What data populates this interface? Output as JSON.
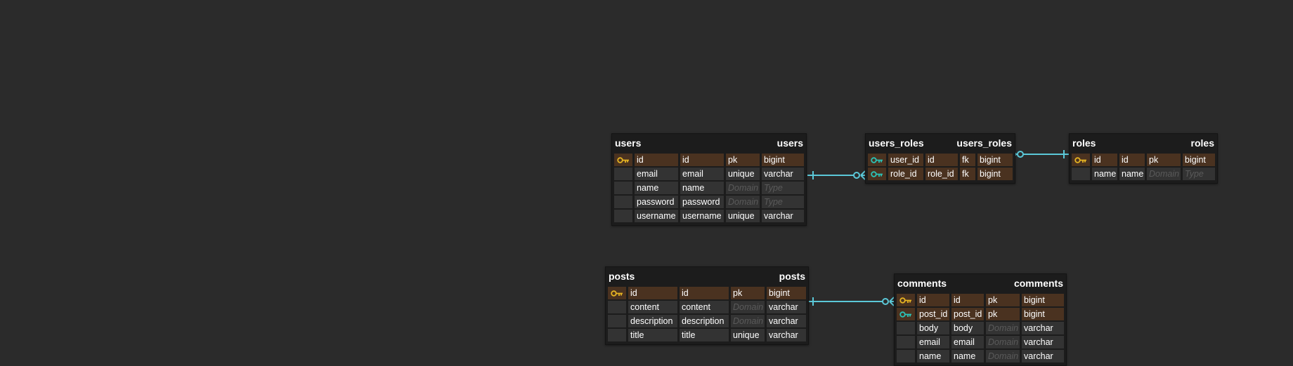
{
  "colors": {
    "background": "#2b2b2b",
    "pk_key": "#e6b422",
    "fk_key": "#2bc4b8",
    "relation_line": "#5bc8d8"
  },
  "placeholders": {
    "domain": "Domain",
    "type": "Type"
  },
  "entities": {
    "users": {
      "name": "users",
      "label": "users",
      "rows": [
        {
          "key": "pk",
          "name": "id",
          "col": "id",
          "domain": "pk",
          "type": "bigint"
        },
        {
          "key": "",
          "name": "email",
          "col": "email",
          "domain": "unique",
          "type": "varchar"
        },
        {
          "key": "",
          "name": "name",
          "col": "name",
          "domain": "",
          "type": ""
        },
        {
          "key": "",
          "name": "password",
          "col": "password",
          "domain": "",
          "type": ""
        },
        {
          "key": "",
          "name": "username",
          "col": "username",
          "domain": "unique",
          "type": "varchar"
        }
      ]
    },
    "users_roles": {
      "name": "users_roles",
      "label": "users_roles",
      "rows": [
        {
          "key": "pkfk",
          "name": "user_id",
          "col": "id",
          "domain": "fk",
          "type": "bigint"
        },
        {
          "key": "pkfk",
          "name": "role_id",
          "col": "role_id",
          "domain": "fk",
          "type": "bigint"
        }
      ]
    },
    "roles": {
      "name": "roles",
      "label": "roles",
      "rows": [
        {
          "key": "pk",
          "name": "id",
          "col": "id",
          "domain": "pk",
          "type": "bigint"
        },
        {
          "key": "",
          "name": "name",
          "col": "name",
          "domain": "",
          "type": ""
        }
      ]
    },
    "posts": {
      "name": "posts",
      "label": "posts",
      "rows": [
        {
          "key": "pk",
          "name": "id",
          "col": "id",
          "domain": "pk",
          "type": "bigint"
        },
        {
          "key": "",
          "name": "content",
          "col": "content",
          "domain": "",
          "type": "varchar"
        },
        {
          "key": "",
          "name": "description",
          "col": "description",
          "domain": "",
          "type": "varchar"
        },
        {
          "key": "",
          "name": "title",
          "col": "title",
          "domain": "unique",
          "type": "varchar"
        }
      ]
    },
    "comments": {
      "name": "comments",
      "label": "comments",
      "rows": [
        {
          "key": "pk",
          "name": "id",
          "col": "id",
          "domain": "pk",
          "type": "bigint"
        },
        {
          "key": "pkfk",
          "name": "post_id",
          "col": "post_id",
          "domain": "pk",
          "type": "bigint"
        },
        {
          "key": "",
          "name": "body",
          "col": "body",
          "domain": "",
          "type": "varchar"
        },
        {
          "key": "",
          "name": "email",
          "col": "email",
          "domain": "",
          "type": "varchar"
        },
        {
          "key": "",
          "name": "name",
          "col": "name",
          "domain": "",
          "type": "varchar"
        }
      ]
    }
  },
  "relations": [
    {
      "from": "users",
      "to": "users_roles",
      "from_end": "one",
      "to_end": "zero-or-many"
    },
    {
      "from": "roles",
      "to": "users_roles",
      "from_end": "one",
      "to_end": "zero-or-many"
    },
    {
      "from": "posts",
      "to": "comments",
      "from_end": "one",
      "to_end": "zero-or-many"
    }
  ]
}
